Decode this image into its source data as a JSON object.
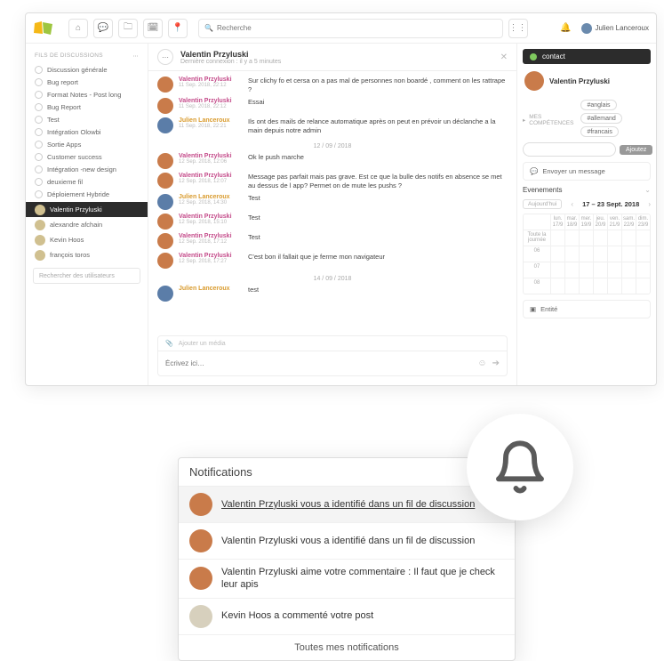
{
  "topbar": {
    "search_placeholder": "Recherche",
    "user_name": "Julien Lanceroux"
  },
  "sidebar": {
    "section_label": "FILS DE DISCUSSIONS",
    "items": [
      {
        "label": "Discussion générale"
      },
      {
        "label": "Bug report"
      },
      {
        "label": "Format Notes - Post long"
      },
      {
        "label": "Bug Report"
      },
      {
        "label": "Test"
      },
      {
        "label": "Intégration Olowbi"
      },
      {
        "label": "Sortie Apps"
      },
      {
        "label": "Customer success"
      },
      {
        "label": "Intégration -new design"
      },
      {
        "label": "deuxieme fil"
      },
      {
        "label": "Déploiement Hybride"
      }
    ],
    "contacts": [
      {
        "label": "Valentin Przyluski",
        "active": true
      },
      {
        "label": "alexandre afchain"
      },
      {
        "label": "Kevin Hoos"
      },
      {
        "label": "françois toros"
      }
    ],
    "user_search_placeholder": "Rechercher des utilisateurs"
  },
  "conversation": {
    "title": "Valentin Przyluski",
    "subtitle": "Dernière connexion : il y a 5 minutes",
    "messages": [
      {
        "author": "Valentin Przyluski",
        "cls": "pink",
        "date": "11 Sep. 2018, 22:12",
        "text": "Sur clichy fo et cersa on a pas mal de personnes non boardé , comment on les rattrape ?"
      },
      {
        "author": "Valentin Przyluski",
        "cls": "pink",
        "date": "11 Sep. 2018, 22:12",
        "text": "Essai"
      },
      {
        "author": "Julien Lanceroux",
        "cls": "orange",
        "date": "11 Sep. 2018, 22:21",
        "text": "Ils ont des mails de relance automatique après on peut en prévoir un déclanche a la main depuis notre admin",
        "av": "blue"
      }
    ],
    "sep1": "12 / 09 / 2018",
    "messages2": [
      {
        "author": "Valentin Przyluski",
        "cls": "pink",
        "date": "12 Sep. 2018, 12:06",
        "text": "Ok le push marche"
      },
      {
        "author": "Valentin Przyluski",
        "cls": "pink",
        "date": "12 Sep. 2018, 12:07",
        "text": "Message pas parfait mais pas grave. Est ce que la bulle des notifs en absence se met au dessus de l app? Permet on de mute les pushs ?"
      },
      {
        "author": "Julien Lanceroux",
        "cls": "orange",
        "date": "12 Sep. 2018, 14:30",
        "text": "Test",
        "av": "blue"
      },
      {
        "author": "Valentin Przyluski",
        "cls": "pink",
        "date": "12 Sep. 2018, 15:10",
        "text": "Test"
      },
      {
        "author": "Valentin Przyluski",
        "cls": "pink",
        "date": "12 Sep. 2018, 17:12",
        "text": "Test"
      },
      {
        "author": "Valentin Przyluski",
        "cls": "pink",
        "date": "12 Sep. 2018, 17:27",
        "text": "C'est bon il fallait que je ferme mon navigateur"
      }
    ],
    "sep2": "14 / 09 / 2018",
    "messages3": [
      {
        "author": "Julien Lanceroux",
        "cls": "orange",
        "date": "",
        "text": "test",
        "av": "blue"
      }
    ],
    "attach_label": "Ajouter un média",
    "compose_placeholder": "Écrivez ici…"
  },
  "rightpanel": {
    "contact_label": "contact",
    "name": "Valentin Przyluski",
    "skills_tag": "MES",
    "skills_label": "COMPÉTENCES",
    "skills": [
      "#anglais",
      "#allemand",
      "#francais"
    ],
    "add_button": "Ajoutez",
    "msg_button": "Envoyer un message",
    "events_label": "Evenements",
    "today_label": "Aujourd'hui",
    "range_label": "17 – 23 Sept. 2018",
    "days": [
      {
        "d": "lun.",
        "n": "17/9"
      },
      {
        "d": "mar.",
        "n": "18/9"
      },
      {
        "d": "mer.",
        "n": "19/9"
      },
      {
        "d": "jeu.",
        "n": "20/9"
      },
      {
        "d": "ven.",
        "n": "21/9"
      },
      {
        "d": "sam.",
        "n": "22/9"
      },
      {
        "d": "dim.",
        "n": "23/9"
      }
    ],
    "rows": [
      "Toute la journée",
      "06",
      "07",
      "08"
    ],
    "entity_label": "Entité"
  },
  "notifications": {
    "title": "Notifications",
    "items": [
      {
        "text": "Valentin Przyluski vous a identifié dans un fil de discussion"
      },
      {
        "text": "Valentin Przyluski vous a identifié dans un fil de discussion"
      },
      {
        "text": "Valentin Przyluski aime votre commentaire : Il faut que je check leur apis"
      },
      {
        "text": "Kevin Hoos a commenté votre post",
        "cls": "grey"
      }
    ],
    "footer": "Toutes mes notifications"
  }
}
